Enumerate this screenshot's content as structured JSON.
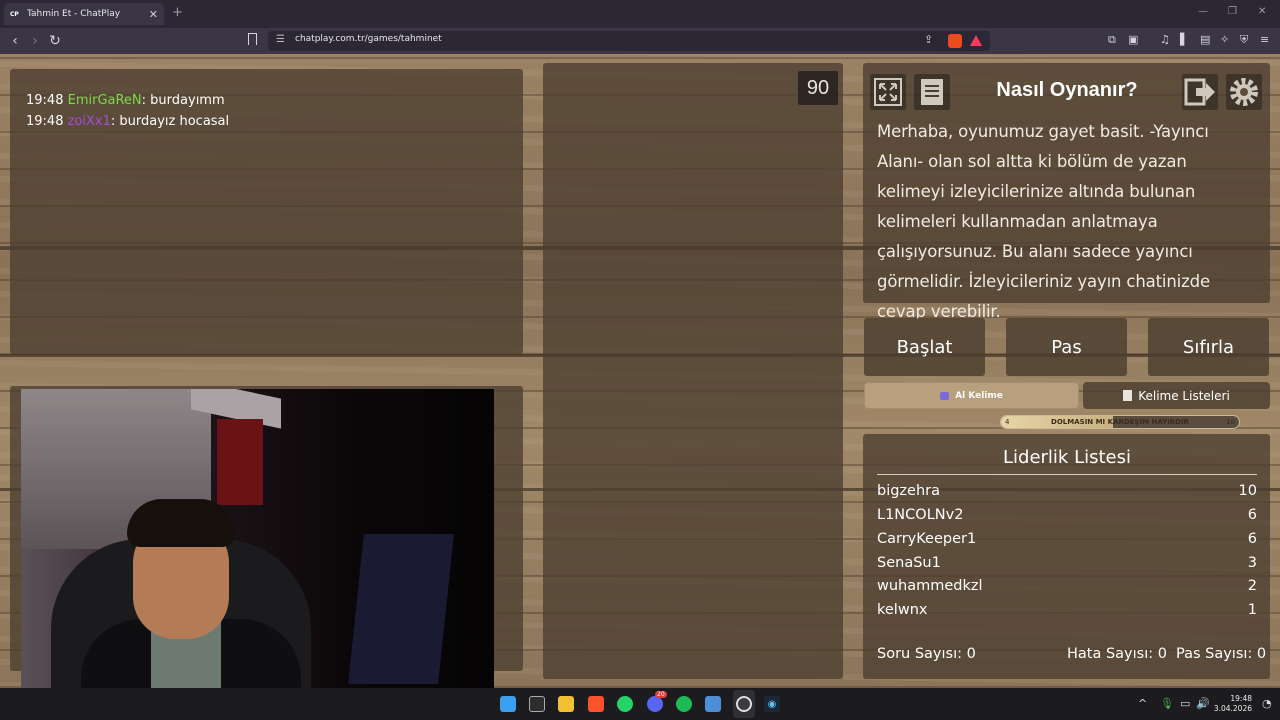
{
  "browser": {
    "tab_icon": "CP",
    "tab_title": "Tahmin Et - ChatPlay",
    "url": "chatplay.com.tr/games/tahminet"
  },
  "chat": {
    "messages": [
      {
        "time": "19:48",
        "user": "EmirGaReN",
        "user_color": "#7cd94a",
        "text": ": burdayımm"
      },
      {
        "time": "19:48",
        "user": "zoiXx1",
        "user_color": "#a44ed6",
        "text": ": burdayız hocasal"
      }
    ]
  },
  "timer": "90",
  "how_to": {
    "title": "Nasıl Oynanır?",
    "text": "Merhaba, oyunumuz gayet basit. -Yayıncı Alanı- olan sol altta ki bölüm de yazan kelimeyi izleyicilerinize altında bulunan kelimeleri kullanmadan anlatmaya çalışıyorsunuz. Bu alanı sadece yayıncı görmelidir. İzleyicileriniz yayın chatinizde cevap verebilir."
  },
  "buttons": {
    "start": "Başlat",
    "pass": "Pas",
    "reset": "Sıfırla",
    "take_word": "Al Kelime",
    "word_lists": "Kelime Listeleri"
  },
  "progress": {
    "label": "DOLMASIN MI KARDEŞİM HAYIRDIR",
    "min": "4",
    "max": "10",
    "fraction": 0.47
  },
  "leaderboard": {
    "title": "Liderlik Listesi",
    "rows": [
      {
        "name": "bigzehra",
        "score": "10"
      },
      {
        "name": "L1NCOLNv2",
        "score": "6"
      },
      {
        "name": "CarryKeeper1",
        "score": "6"
      },
      {
        "name": "SenaSu1",
        "score": "3"
      },
      {
        "name": "wuhammedkzl",
        "score": "2"
      },
      {
        "name": "kelwnx",
        "score": "1"
      }
    ]
  },
  "stats": {
    "questions": "Soru Sayısı: 0",
    "errors": "Hata Sayısı: 0",
    "passes": "Pas Sayısı: 0"
  },
  "taskbar": {
    "time": "19:48",
    "date": "3.04.2026",
    "discord_badge": "20"
  }
}
